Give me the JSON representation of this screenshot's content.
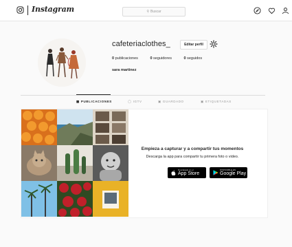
{
  "header": {
    "wordmark": "Instagram",
    "search_placeholder": "Buscar",
    "icons": [
      "instagram-glyph-icon",
      "compass-icon",
      "heart-icon",
      "person-icon"
    ]
  },
  "profile": {
    "username": "cafeteriaclothes_",
    "edit_button": "Editar perfil",
    "settings_icon": "gear-icon",
    "stats": [
      {
        "count": "0",
        "label": "publicaciones"
      },
      {
        "count": "0",
        "label": "seguidores"
      },
      {
        "count": "0",
        "label": "seguidos"
      }
    ],
    "full_name": "sara martinez"
  },
  "tabs": [
    {
      "label": "PUBLICACIONES",
      "icon": "grid-icon",
      "active": true
    },
    {
      "label": "IGTV",
      "icon": "tv-icon",
      "active": false
    },
    {
      "label": "GUARDADO",
      "icon": "bookmark-icon",
      "active": false
    },
    {
      "label": "ETIQUETADAS",
      "icon": "tag-icon",
      "active": false
    }
  ],
  "empty_state": {
    "title": "Empieza a capturar y a compartir tus momentos",
    "subtitle": "Descarga la app para compartir tu primera foto o video.",
    "app_store": {
      "small": "Descárgalo en el",
      "big": "App Store"
    },
    "google_play": {
      "small": "DISPONIBLE EN",
      "big": "Google Play"
    }
  },
  "colors": {
    "background": "#fafafa",
    "text": "#262626",
    "muted": "#999999",
    "border": "#dbdbdb"
  }
}
